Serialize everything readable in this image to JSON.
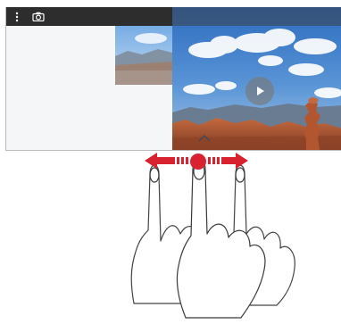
{
  "icons": {
    "more": "more-vert-icon",
    "camera": "camera-icon",
    "menu": "menu-icon",
    "play": "play-icon",
    "swipe": "swipe-left-right-arrows-icon",
    "hands": "hand-gesture-icon"
  },
  "colors": {
    "topbar": "#2d2d2d",
    "arrow_red": "#d9222f",
    "sky_blue": "#3f7fc8",
    "rock_orange": "#c8643c"
  }
}
